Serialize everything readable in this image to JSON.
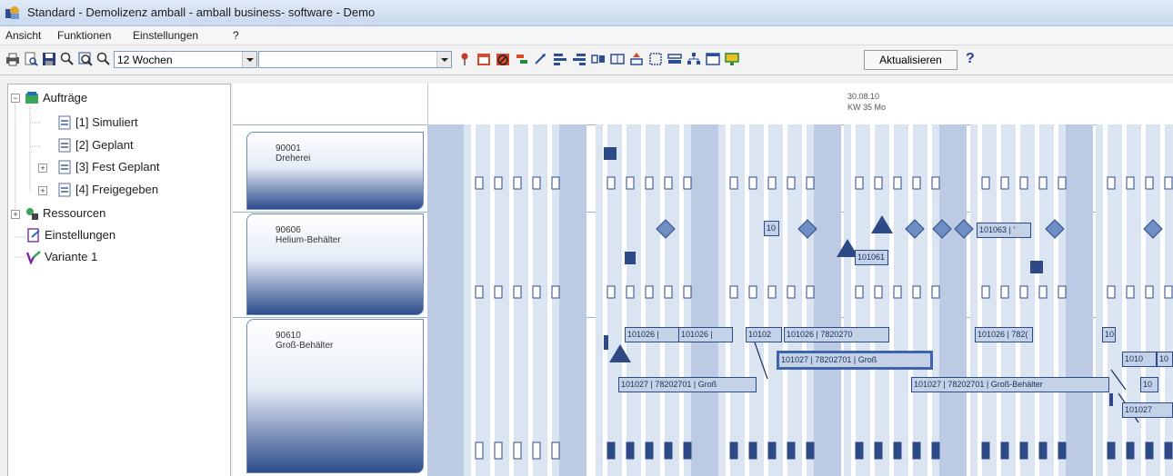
{
  "window": {
    "title": "Standard - Demolizenz amball - amball business- software - Demo",
    "app_icon": "amball-app-icon"
  },
  "menu": {
    "items": [
      "Ansicht",
      "Funktionen",
      "Einstellungen",
      "?"
    ]
  },
  "toolbar": {
    "period_select": "12 Wochen",
    "filter_select": "",
    "refresh_label": "Aktualisieren",
    "help_label": "?"
  },
  "tree": {
    "nodes": [
      {
        "label": "Aufträge",
        "icon": "orders-icon"
      },
      {
        "label": "[1] Simuliert",
        "icon": "document-icon"
      },
      {
        "label": "[2] Geplant",
        "icon": "document-icon"
      },
      {
        "label": "[3] Fest Geplant",
        "icon": "document-icon"
      },
      {
        "label": "[4] Freigegeben",
        "icon": "document-icon"
      },
      {
        "label": "Ressourcen",
        "icon": "resources-icon"
      },
      {
        "label": "Einstellungen",
        "icon": "settings-icon"
      },
      {
        "label": "Variante 1",
        "icon": "variant-icon"
      }
    ]
  },
  "gantt": {
    "header_date": "30.08.10",
    "header_week": "KW 35 Mo",
    "resources": [
      {
        "id": "90001",
        "name": "Dreherei"
      },
      {
        "id": "90606",
        "name": "Helium-Behälter"
      },
      {
        "id": "90610",
        "name": "Groß-Behälter"
      }
    ],
    "labels": [
      "10",
      "101061 |",
      "101063 | '",
      "101026 |",
      "101026 |",
      "10102",
      "101026 | 7820270",
      "101026 | 782(",
      "10",
      "101027 | 78202701 | Groß",
      "101027 | 78202701 | Groß",
      "101027 | 78202701 | Groß-Behälter",
      "1010",
      "10",
      "10",
      "101027"
    ]
  },
  "colors": {
    "accent": "#2d4a86",
    "light_band": "#dbe4f1",
    "dark_band": "#bccbe3",
    "bar_fill": "#c4d2e8"
  }
}
